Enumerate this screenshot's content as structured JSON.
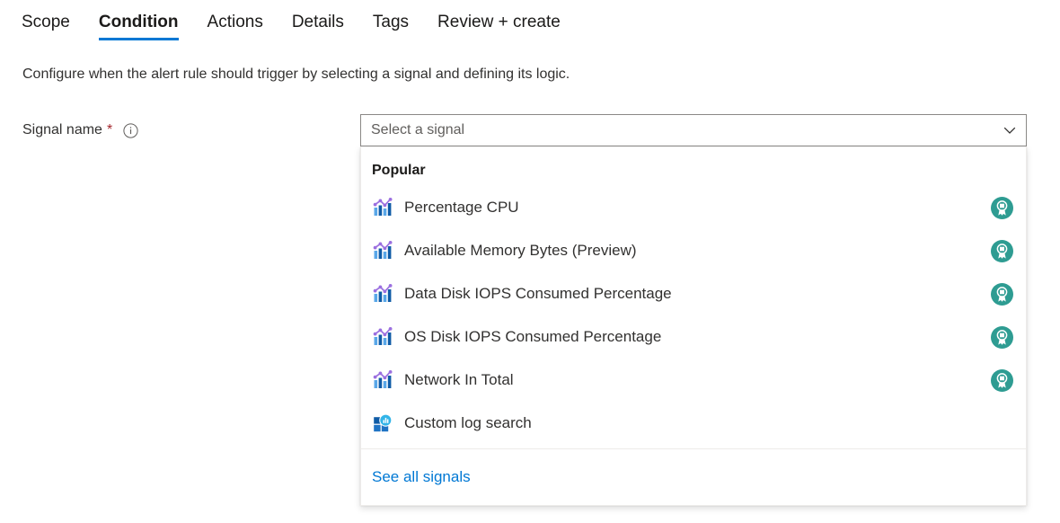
{
  "tabs": [
    {
      "label": "Scope",
      "active": false
    },
    {
      "label": "Condition",
      "active": true
    },
    {
      "label": "Actions",
      "active": false
    },
    {
      "label": "Details",
      "active": false
    },
    {
      "label": "Tags",
      "active": false
    },
    {
      "label": "Review + create",
      "active": false
    }
  ],
  "description": "Configure when the alert rule should trigger by selecting a signal and defining its logic.",
  "field": {
    "label": "Signal name",
    "required_marker": "*",
    "info_icon": "info-circle-icon"
  },
  "combo": {
    "placeholder": "Select a signal",
    "value": "",
    "chevron_icon": "chevron-down-icon"
  },
  "dropdown": {
    "group_header": "Popular",
    "options": [
      {
        "label": "Percentage CPU",
        "icon": "metric-chart-icon",
        "badge": "recommended-award-icon"
      },
      {
        "label": "Available Memory Bytes (Preview)",
        "icon": "metric-chart-icon",
        "badge": "recommended-award-icon"
      },
      {
        "label": "Data Disk IOPS Consumed Percentage",
        "icon": "metric-chart-icon",
        "badge": "recommended-award-icon"
      },
      {
        "label": "OS Disk IOPS Consumed Percentage",
        "icon": "metric-chart-icon",
        "badge": "recommended-award-icon"
      },
      {
        "label": "Network In Total",
        "icon": "metric-chart-icon",
        "badge": "recommended-award-icon"
      },
      {
        "label": "Custom log search",
        "icon": "log-search-icon",
        "badge": ""
      }
    ],
    "footer_link": "See all signals"
  },
  "colors": {
    "accent": "#0078d4",
    "link": "#0078d4",
    "required": "#a4262c",
    "badge_teal": "#2e9c92",
    "text": "#323130",
    "placeholder": "#605e5c",
    "border": "#8a8886"
  }
}
